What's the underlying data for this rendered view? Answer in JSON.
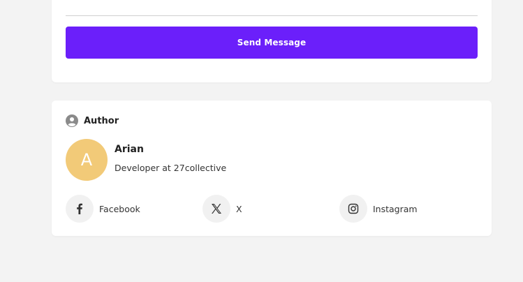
{
  "contact": {
    "send_label": "Send Message"
  },
  "author": {
    "section_title": "Author",
    "avatar_initial": "A",
    "name": "Arian",
    "role": "Developer at 27collective"
  },
  "socials": [
    {
      "label": "Facebook",
      "icon": "facebook-icon"
    },
    {
      "label": "X",
      "icon": "x-icon"
    },
    {
      "label": "Instagram",
      "icon": "instagram-icon"
    }
  ],
  "colors": {
    "accent": "#6b1ffa",
    "avatar_bg": "#f2ca78",
    "icon_gray": "#8a8a8a",
    "icon_dark": "#333333"
  }
}
